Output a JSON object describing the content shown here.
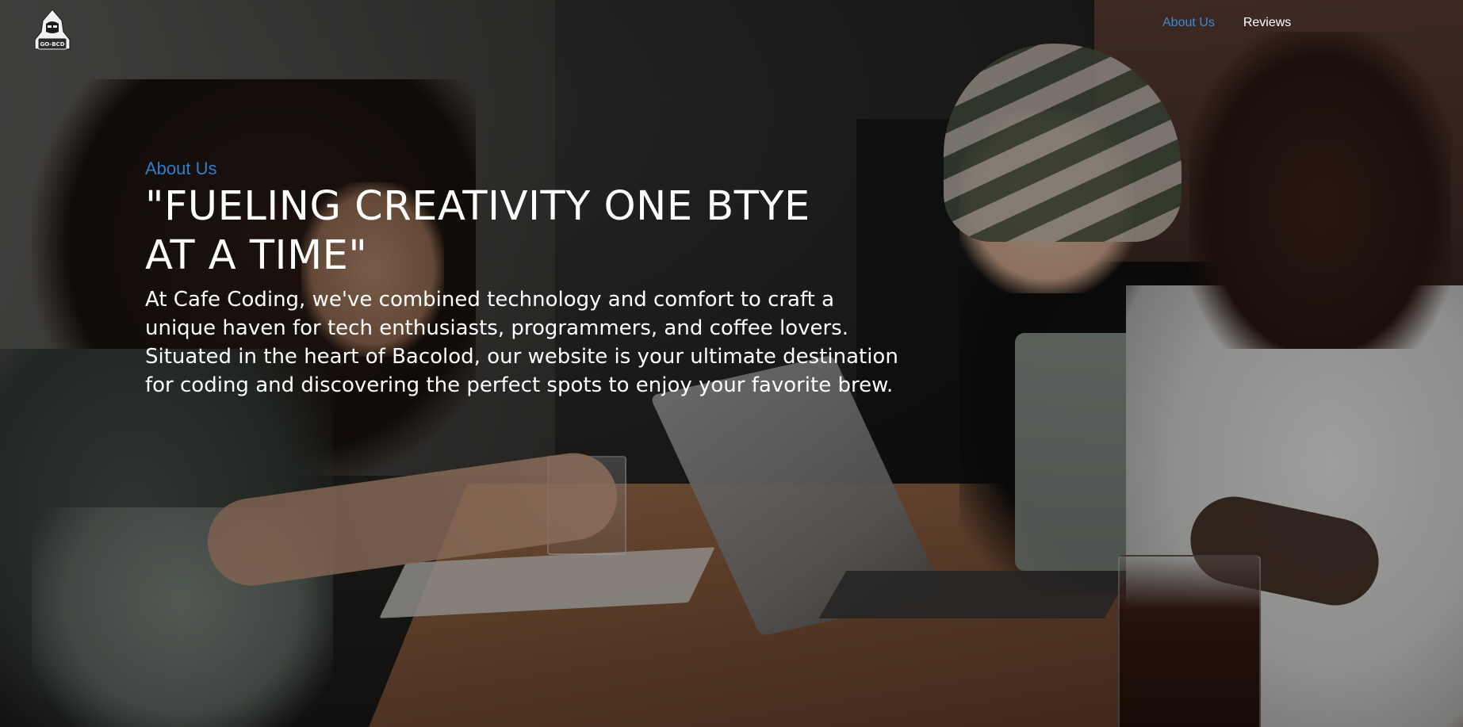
{
  "brand": {
    "logo_text": "GO-BCD",
    "logo_icon": "hooded-hacker-icon"
  },
  "nav": {
    "items": [
      {
        "label": "About Us",
        "active": true
      },
      {
        "label": "Reviews",
        "active": false
      }
    ]
  },
  "hero": {
    "eyebrow": "About Us",
    "headline": "\"FUELING CREATIVITY ONE BTYE AT A TIME\"",
    "description": "At Cafe Coding, we've combined technology and comfort to craft a unique haven for tech enthusiasts, programmers, and coffee lovers. Situated in the heart of Bacolod, our website is your ultimate destination for coding and discovering the perfect spots to enjoy your favorite brew."
  },
  "colors": {
    "accent": "#2f7fcf",
    "nav_active": "#3a8ad6",
    "text": "#ffffff"
  }
}
